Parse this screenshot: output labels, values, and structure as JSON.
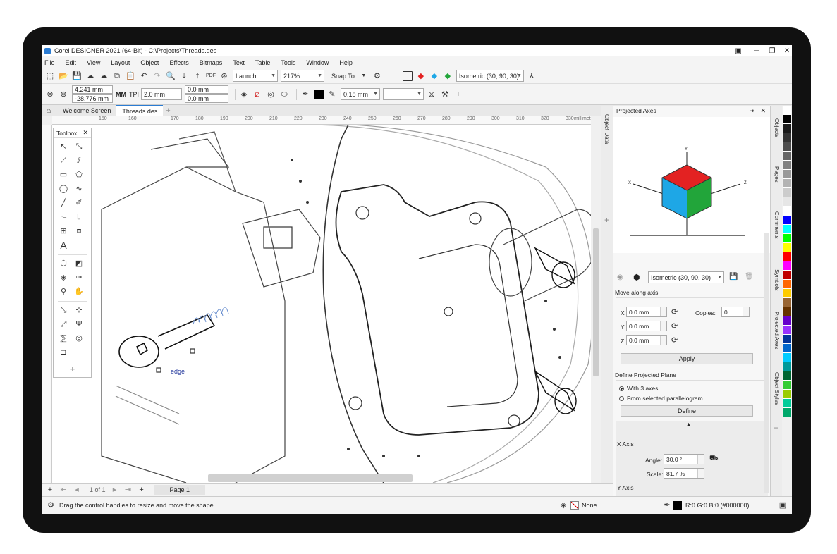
{
  "window": {
    "title": "Corel DESIGNER 2021 (64-Bit) - C:\\Projects\\Threads.des"
  },
  "menu": [
    "File",
    "Edit",
    "View",
    "Layout",
    "Object",
    "Effects",
    "Bitmaps",
    "Text",
    "Table",
    "Tools",
    "Window",
    "Help"
  ],
  "toolbar1": {
    "launch_label": "Launch",
    "zoom_value": "217%",
    "snap_label": "Snap To",
    "projection_value": "Isometric (30, 90, 30)"
  },
  "toolbar2": {
    "x_value": "4.241 mm",
    "y_value": "-28.776 mm",
    "tpi_label": "TPI",
    "tpi_value": "2.0 mm",
    "offset1_value": "0.0 mm",
    "offset2_value": "0.0 mm",
    "outline_width": "0.18 mm",
    "mm_label": "MM"
  },
  "tabs": [
    {
      "label": "Welcome Screen"
    },
    {
      "label": "Threads.des"
    }
  ],
  "ruler": {
    "ticks": [
      "170",
      "180",
      "190",
      "200",
      "210",
      "220",
      "230",
      "240",
      "250",
      "260",
      "270",
      "280",
      "290",
      "300",
      "310",
      "320",
      "330"
    ],
    "left_ticks": [
      "150",
      "160"
    ],
    "unit": "millimeters"
  },
  "toolbox": {
    "title": "Toolbox"
  },
  "canvas": {
    "edge_label": "edge"
  },
  "pager": {
    "page_info": "1 of 1",
    "page_tab": "Page 1"
  },
  "status": {
    "hint": "Drag the control handles to resize and move the shape.",
    "fill_value": "None",
    "outline_value": "R:0 G:0 B:0 (#000000)"
  },
  "docker": {
    "title": "Projected Axes",
    "axis_labels": {
      "x": "X",
      "y": "Y",
      "z": "Z"
    },
    "projection_value": "Isometric (30, 90, 30)",
    "move_section": "Move along axis",
    "x_label": "X",
    "x_value": "0.0 mm",
    "y_label": "Y",
    "y_value": "0.0 mm",
    "z_label": "Z",
    "z_value": "0.0 mm",
    "copies_label": "Copies:",
    "copies_value": "0",
    "apply_label": "Apply",
    "plane_section": "Define Projected Plane",
    "radio1": "With 3 axes",
    "radio2": "From selected parallelogram",
    "define_label": "Define",
    "xaxis_section": "X Axis",
    "angle_label": "Angle:",
    "angle_value": "30.0 °",
    "scale_label": "Scale:",
    "scale_value": "81.7 %",
    "yaxis_section": "Y Axis"
  },
  "side_tabs": {
    "object_data": "Object Data",
    "objects": "Objects",
    "pages": "Pages",
    "comments": "Comments",
    "symbols": "Symbols",
    "projected_axes": "Projected Axes",
    "object_styles": "Object Styles"
  },
  "palette": [
    "#ffffff",
    "#000000",
    "#1a1a1a",
    "#333333",
    "#4d4d4d",
    "#666666",
    "#808080",
    "#999999",
    "#b3b3b3",
    "#cccccc",
    "#e6e6e6",
    "#ffffff",
    "#0000ff",
    "#00ffff",
    "#00ff00",
    "#ffff00",
    "#ff0000",
    "#ff00ff",
    "#c00000",
    "#ff6600",
    "#ffcc00",
    "#996633",
    "#663300",
    "#6600cc",
    "#9933ff",
    "#003399",
    "#0066cc",
    "#00ccff",
    "#009999",
    "#006633",
    "#33cc33",
    "#99cc00",
    "#00cc99",
    "#00a86b"
  ],
  "colors": {
    "accent": "#2b7cd3",
    "cube_top": "#e32222",
    "cube_left": "#1ea7e6",
    "cube_right": "#22a53a"
  }
}
